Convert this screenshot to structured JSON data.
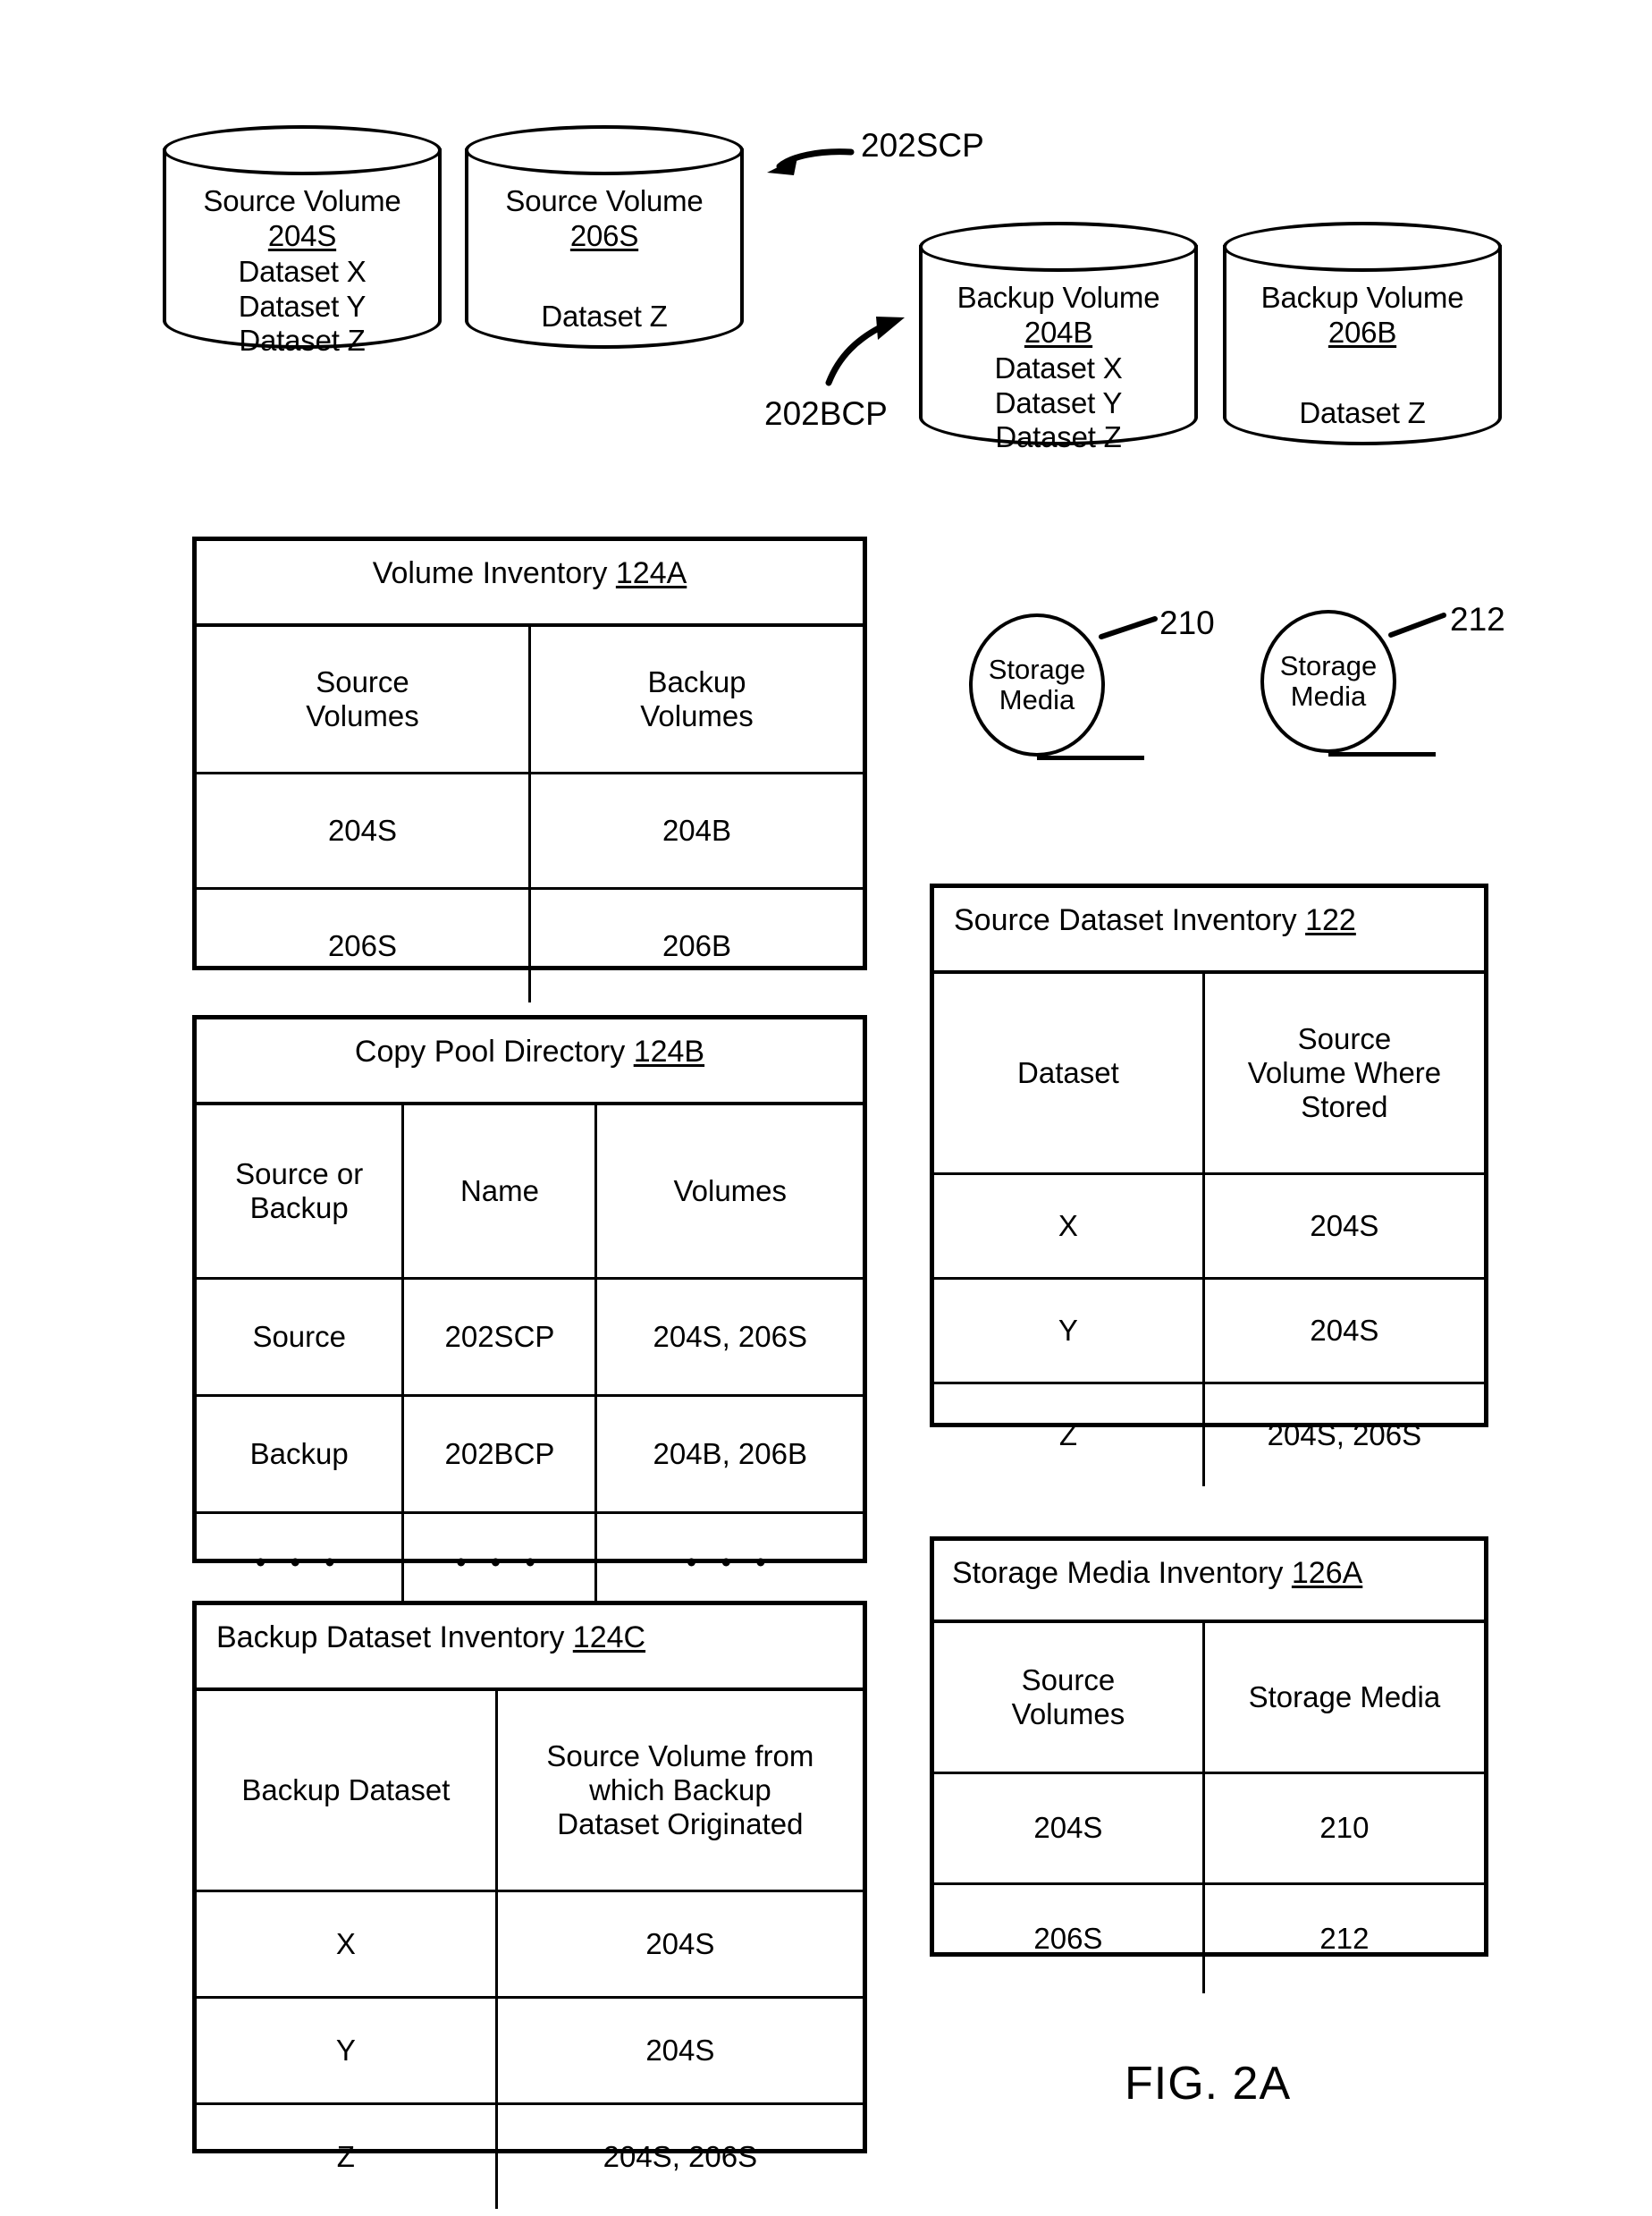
{
  "figure": {
    "caption": "FIG. 2A"
  },
  "source_copy_pool": {
    "ref_label": "202SCP",
    "volumes": [
      {
        "title": "Source Volume",
        "id": "204S",
        "datasets": [
          "Dataset X",
          "Dataset Y",
          "Dataset Z"
        ]
      },
      {
        "title": "Source Volume",
        "id": "206S",
        "datasets": [
          "Dataset Z"
        ]
      }
    ]
  },
  "backup_copy_pool": {
    "ref_label": "202BCP",
    "volumes": [
      {
        "title": "Backup Volume",
        "id": "204B",
        "datasets": [
          "Dataset X",
          "Dataset Y",
          "Dataset Z"
        ]
      },
      {
        "title": "Backup Volume",
        "id": "206B",
        "datasets": [
          "Dataset Z"
        ]
      }
    ]
  },
  "storage_media": [
    {
      "label_line1": "Storage",
      "label_line2": "Media",
      "ref": "210"
    },
    {
      "label_line1": "Storage",
      "label_line2": "Media",
      "ref": "212"
    }
  ],
  "volume_inventory": {
    "title": "Volume Inventory ",
    "ref": "124A",
    "headers": [
      "Source\nVolumes",
      "Backup\nVolumes"
    ],
    "header_lines": [
      [
        "Source",
        "Volumes"
      ],
      [
        "Backup",
        "Volumes"
      ]
    ],
    "rows": [
      [
        "204S",
        "204B"
      ],
      [
        "206S",
        "206B"
      ]
    ]
  },
  "copy_pool_directory": {
    "title": "Copy Pool Directory ",
    "ref": "124B",
    "header_lines": [
      [
        "Source or",
        "Backup"
      ],
      [
        "Name"
      ],
      [
        "Volumes"
      ]
    ],
    "rows": [
      [
        "Source",
        "202SCP",
        "204S, 206S"
      ],
      [
        "Backup",
        "202BCP",
        "204B, 206B"
      ],
      [
        "• • •",
        "• • •",
        "• • •"
      ]
    ]
  },
  "backup_dataset_inventory": {
    "title": "Backup Dataset Inventory ",
    "ref": "124C",
    "header_lines": [
      [
        "Backup Dataset"
      ],
      [
        "Source Volume from",
        "which Backup",
        "Dataset Originated"
      ]
    ],
    "rows": [
      [
        "X",
        "204S"
      ],
      [
        "Y",
        "204S"
      ],
      [
        "Z",
        "204S, 206S"
      ]
    ]
  },
  "source_dataset_inventory": {
    "title": "Source Dataset Inventory ",
    "ref": "122",
    "header_lines": [
      [
        "Dataset"
      ],
      [
        "Source",
        "Volume Where",
        "Stored"
      ]
    ],
    "rows": [
      [
        "X",
        "204S"
      ],
      [
        "Y",
        "204S"
      ],
      [
        "Z",
        "204S, 206S"
      ]
    ]
  },
  "storage_media_inventory": {
    "title": "Storage Media Inventory ",
    "ref": "126A",
    "header_lines": [
      [
        "Source",
        "Volumes"
      ],
      [
        "Storage Media"
      ]
    ],
    "rows": [
      [
        "204S",
        "210"
      ],
      [
        "206S",
        "212"
      ]
    ]
  }
}
